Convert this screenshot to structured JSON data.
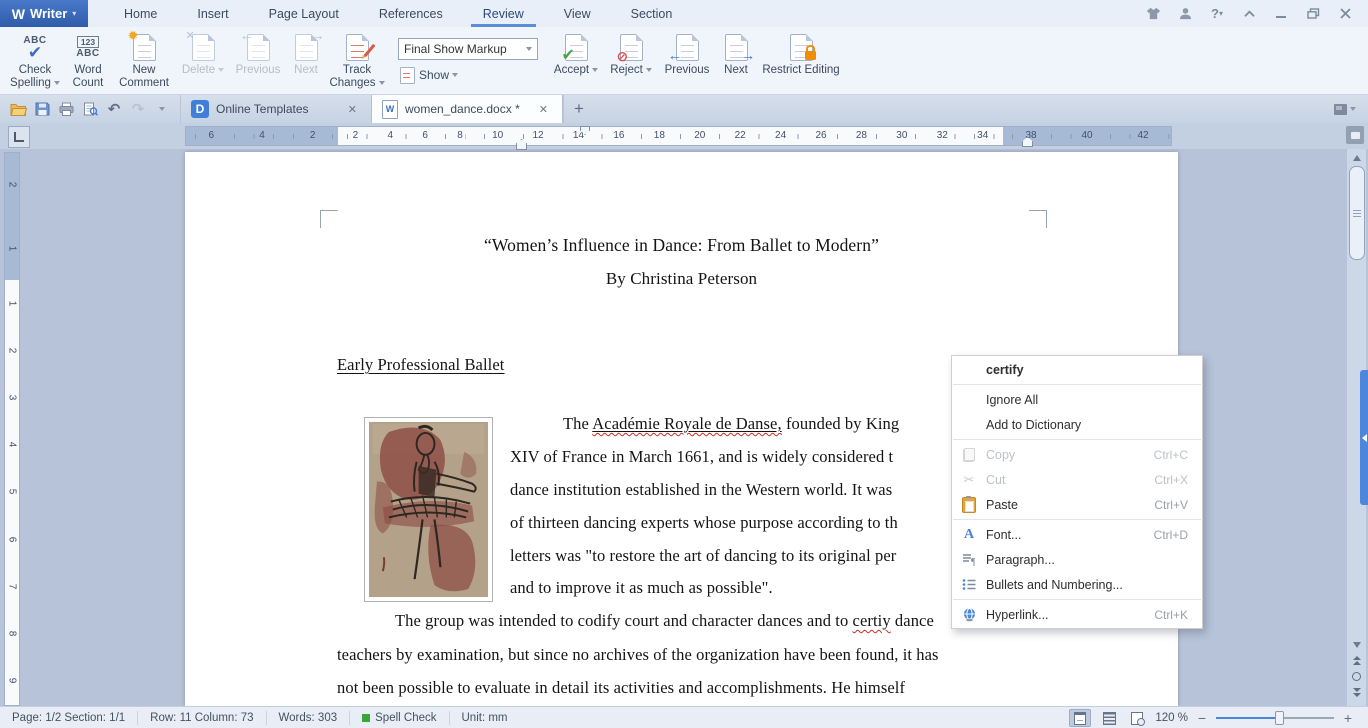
{
  "titlebar": {
    "app_name": "Writer",
    "menus": [
      "Home",
      "Insert",
      "Page Layout",
      "References",
      "Review",
      "View",
      "Section"
    ],
    "active_menu": "Review",
    "help_label": "?"
  },
  "ribbon": {
    "check_spelling": "Check Spelling",
    "word_count": "Word Count",
    "new_comment": "New Comment",
    "delete": "Delete",
    "previous_comment": "Previous",
    "next_comment": "Next",
    "track_changes": "Track Changes",
    "markup_selector": "Final Show Markup",
    "show": "Show",
    "accept": "Accept",
    "reject": "Reject",
    "previous_change": "Previous",
    "next_change": "Next",
    "restrict_editing": "Restrict Editing"
  },
  "tabbar": {
    "tab1": "Online Templates",
    "tab2": "women_dance.docx *"
  },
  "ruler": {
    "left_numbers": [
      "6",
      "4",
      "2"
    ],
    "center_numbers": [
      "2",
      "4",
      "6",
      "8",
      "10",
      "12",
      "14",
      "16",
      "18",
      "20",
      "22",
      "24",
      "26",
      "28",
      "30",
      "32",
      "34"
    ],
    "right_numbers": [
      "38",
      "40",
      "42"
    ],
    "v_margin_numbers": [
      "2",
      "1"
    ],
    "v_numbers": [
      "1",
      "2",
      "3",
      "4",
      "5",
      "6",
      "7",
      "8",
      "9"
    ]
  },
  "document": {
    "title": "“Women’s Influence in Dance: From Ballet to Modern”",
    "byline": "By Christina Peterson",
    "heading": "Early Professional Ballet",
    "p1_l1_pre": "The ",
    "p1_l1_term": "Académie Royale de Danse,",
    "p1_l1_post": " founded by King",
    "p1_l2": "XIV of France in March 1661, and is widely considered t",
    "p1_l3": "dance institution established in the Western world. It was",
    "p1_l4": "of thirteen dancing experts whose purpose according to th",
    "p1_l5": "letters was \"to restore the art of dancing to its original per",
    "p1_l6": "and to improve it as much as possible\".",
    "p2_l1_pre": "The group was intended to codify court and character dances and to ",
    "p2_l1_typo": "certiy",
    "p2_l1_post": " dance",
    "p2_l2": "teachers by examination, but since no archives of the organization have been found, it has",
    "p2_l3": "not been possible to evaluate in detail its activities and accomplishments. He himself"
  },
  "context_menu": {
    "items": [
      {
        "label": "certify",
        "shortcut": "",
        "enabled": true
      },
      {
        "label": "Ignore All",
        "shortcut": "",
        "enabled": true
      },
      {
        "label": "Add to Dictionary",
        "shortcut": "",
        "enabled": true
      },
      {
        "label": "Copy",
        "shortcut": "Ctrl+C",
        "enabled": false
      },
      {
        "label": "Cut",
        "shortcut": "Ctrl+X",
        "enabled": false
      },
      {
        "label": "Paste",
        "shortcut": "Ctrl+V",
        "enabled": true
      },
      {
        "label": "Font...",
        "shortcut": "Ctrl+D",
        "enabled": true
      },
      {
        "label": "Paragraph...",
        "shortcut": "",
        "enabled": true
      },
      {
        "label": "Bullets and Numbering...",
        "shortcut": "",
        "enabled": true
      },
      {
        "label": "Hyperlink...",
        "shortcut": "Ctrl+K",
        "enabled": true
      }
    ]
  },
  "statusbar": {
    "page_info": "Page: 1/2 Section: 1/1",
    "cursor_info": "Row: 11 Column: 73",
    "word_count": "Words: 303",
    "spell_check": "Spell Check",
    "unit": "Unit: mm",
    "zoom_level": "120 %"
  },
  "colors": {
    "accent_blue": "#3a6fc4",
    "sidebar_blue": "#4d86dd",
    "squiggle_red": "#cc2a1e",
    "lock_orange": "#ef8c0a",
    "spellcheck_green": "#3aa63a"
  }
}
